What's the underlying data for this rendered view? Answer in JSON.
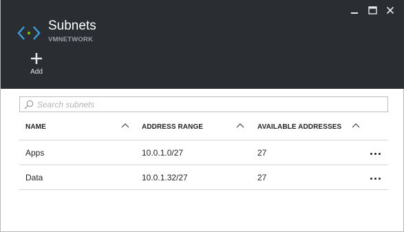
{
  "blade": {
    "title": "Subnets",
    "subtitle": "VMNETWORK"
  },
  "commands": {
    "add_label": "Add"
  },
  "search": {
    "placeholder": "Search subnets",
    "value": ""
  },
  "table": {
    "headers": [
      "NAME",
      "ADDRESS RANGE",
      "AVAILABLE ADDRESSES"
    ],
    "rows": [
      {
        "name": "Apps",
        "address_range": "10.0.1.0/27",
        "available": "27"
      },
      {
        "name": "Data",
        "address_range": "10.0.1.32/27",
        "available": "27"
      }
    ]
  },
  "colors": {
    "header_bg": "#2a2d31",
    "icon_blue": "#3ba0e0",
    "icon_dot": "#7fba00"
  },
  "icons": [
    "minimize-icon",
    "maximize-icon",
    "close-icon",
    "virtual-network-icon",
    "add-icon",
    "search-icon",
    "sort-icon",
    "more-icon"
  ]
}
